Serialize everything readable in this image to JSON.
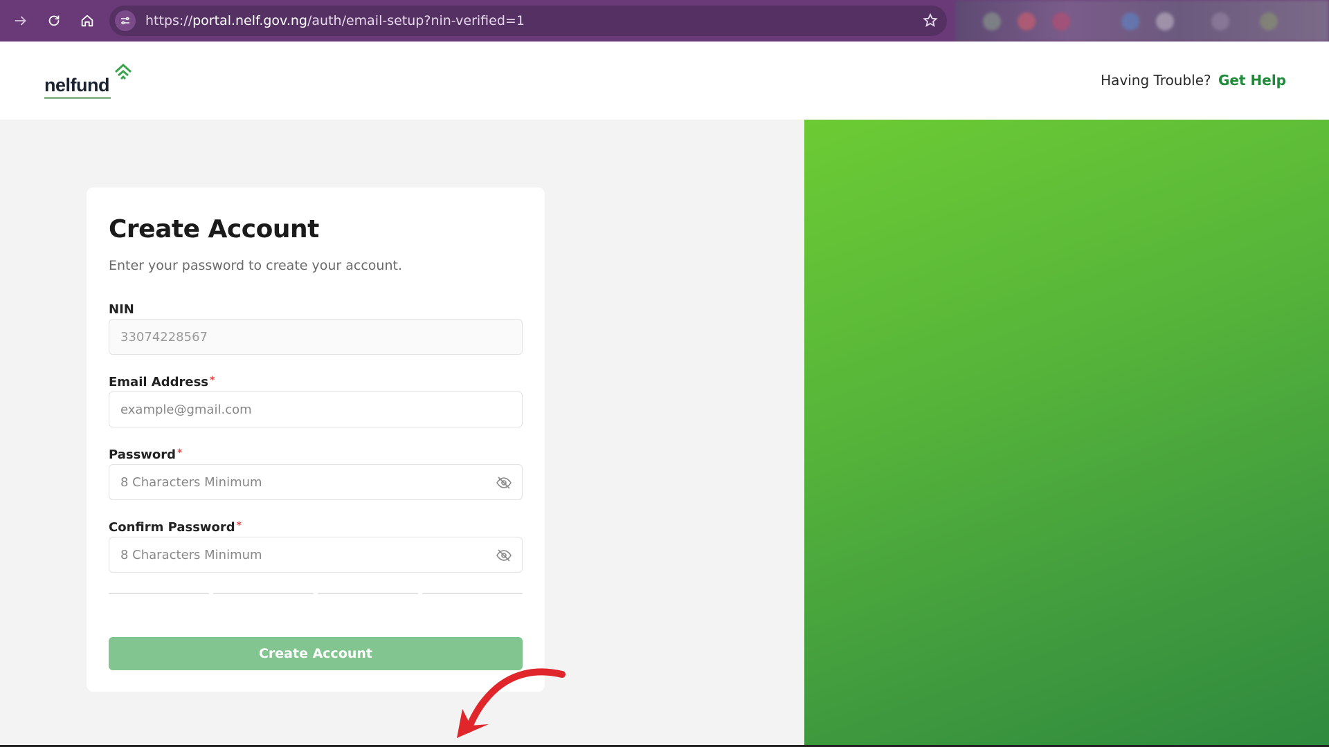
{
  "browser": {
    "url_prefix": "https://",
    "url_host": "portal.nelf.gov.ng",
    "url_path": "/auth/email-setup?nin-verified=1"
  },
  "header": {
    "logo_text": "nelfund",
    "help_text": "Having Trouble?",
    "help_link": "Get Help"
  },
  "form": {
    "title": "Create Account",
    "subtitle": "Enter your password to create your account.",
    "nin": {
      "label": "NIN",
      "value": "33074228567"
    },
    "email": {
      "label": "Email Address",
      "required": "*",
      "placeholder": "example@gmail.com"
    },
    "password": {
      "label": "Password",
      "required": "*",
      "placeholder": "8 Characters Minimum"
    },
    "confirm": {
      "label": "Confirm Password",
      "required": "*",
      "placeholder": "8 Characters Minimum"
    },
    "submit_label": "Create Account"
  },
  "colors": {
    "chrome": "#6a3a78",
    "accent": "#1f8a3a",
    "button": "#83c591",
    "panel_green": "#56b43a",
    "arrow": "#e0262b"
  }
}
